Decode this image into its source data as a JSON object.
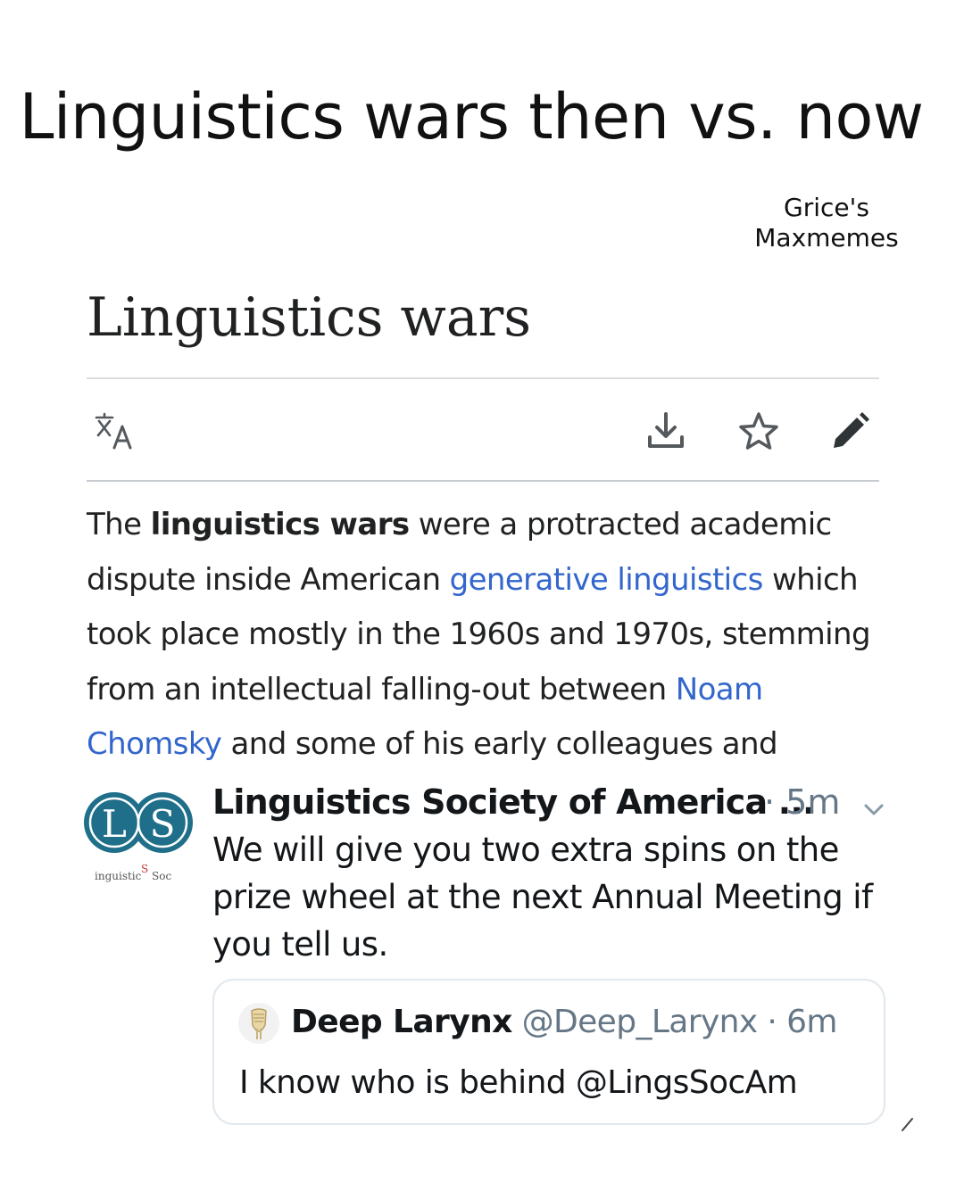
{
  "meme": {
    "title": "Linguistics wars then vs. now",
    "watermark_line1": "Grice's",
    "watermark_line2": "Maxmemes"
  },
  "article": {
    "title": "Linguistics wars",
    "toolbar": {
      "language_icon": "translate-icon",
      "download_icon": "download-icon",
      "watch_icon": "star-icon",
      "edit_icon": "pencil-icon"
    },
    "body": {
      "p1": "The ",
      "bold": "linguistics wars",
      "p2": " were a protracted academic dispute inside American ",
      "link1": "generative linguistics",
      "p3": " which took place mostly in the 1960s and 1970s, stemming from an intellectual falling-out between ",
      "link2": "Noam Chomsky",
      "p4": " and some of his early colleagues and"
    },
    "link_color": "#3366cc"
  },
  "tweet": {
    "author": "Linguistics Society of America ...",
    "time": "· 5m",
    "text": "We will give you two extra spins on the prize wheel at the next Annual Meeting if you tell us.",
    "avatar": {
      "letters": "LS",
      "caption_left": "inguistic",
      "caption_mid": "S",
      "caption_right": "Soc"
    },
    "quoted": {
      "name": "Deep Larynx",
      "handle": "@Deep_Larynx · 6m",
      "text": "I know who is behind @LingsSocAm"
    }
  }
}
